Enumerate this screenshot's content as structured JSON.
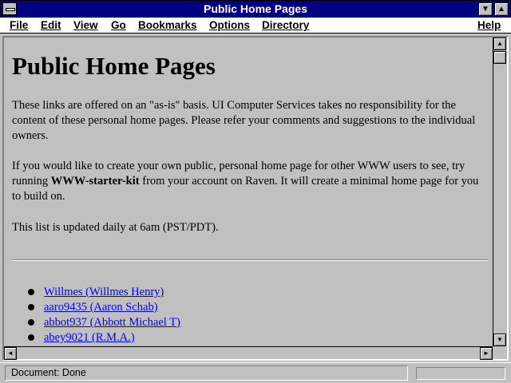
{
  "window": {
    "title": "Public Home Pages",
    "minimize_glyph": "▼",
    "maximize_glyph": "▲"
  },
  "menu": {
    "file": "File",
    "edit": "Edit",
    "view": "View",
    "go": "Go",
    "bookmarks": "Bookmarks",
    "options": "Options",
    "directory": "Directory",
    "help": "Help"
  },
  "document": {
    "heading": "Public Home Pages",
    "para1": "These links are offered on an \"as-is\" basis. UI Computer Services takes no responsibility for the content of these personal home pages. Please refer your comments and suggestions to the individual owners.",
    "para2_before": "If you would like to create your own public, personal home page for other WWW users to see, try running ",
    "para2_bold": "WWW-starter-kit",
    "para2_after": " from your account on Raven. It will create a minimal home page for you to build on.",
    "para3": "This list is updated daily at 6am (PST/PDT).",
    "links": [
      "Willmes (Willmes Henry)",
      "aaro9435 (Aaron Schab)",
      "abbot937 (Abbott Michael T)",
      "abey9021 (R.M.A.)"
    ]
  },
  "scrollbars": {
    "up_arrow": "▲",
    "down_arrow": "▼",
    "left_arrow": "◄",
    "right_arrow": "►"
  },
  "status": {
    "text": "Document: Done"
  },
  "colors": {
    "titlebar": "#000080",
    "window_bg": "#c0c0c0",
    "link": "#0000ff"
  }
}
